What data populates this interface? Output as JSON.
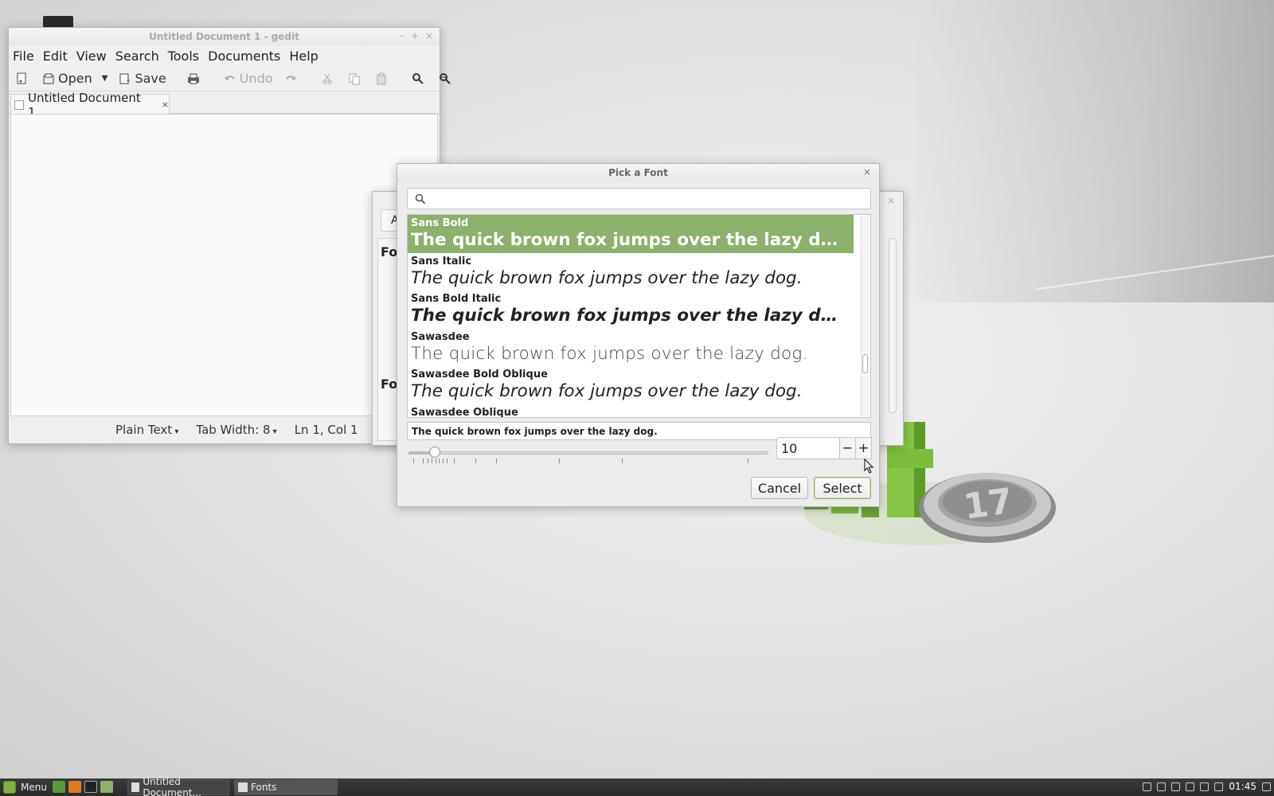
{
  "gedit": {
    "title": "Untitled Document 1 - gedit",
    "window_controls": [
      "–",
      "+",
      "×"
    ],
    "menu": [
      "File",
      "Edit",
      "View",
      "Search",
      "Tools",
      "Documents",
      "Help"
    ],
    "toolbar": {
      "open_label": "Open",
      "save_label": "Save",
      "undo_label": "Undo"
    },
    "tab": {
      "label": "Untitled Document 1",
      "close": "×"
    },
    "status": {
      "language": "Plain Text",
      "tab_width": "Tab Width:  8",
      "position": "Ln 1, Col 1"
    }
  },
  "fonts_window": {
    "button_partial": "A",
    "label_1": "Fo",
    "label_2": "Fo",
    "close": "×"
  },
  "dialog": {
    "title": "Pick a Font",
    "close": "×",
    "search_placeholder": "",
    "fonts": [
      {
        "name": "Sans Bold",
        "sample": "The quick brown fox jumps over the lazy d…",
        "style": "bold",
        "selected": true
      },
      {
        "name": "Sans Italic",
        "sample": "The quick brown fox jumps over the lazy dog.",
        "style": "italic",
        "selected": false
      },
      {
        "name": "Sans Bold Italic",
        "sample": "The quick brown fox jumps over the lazy d…",
        "style": "bolditalic",
        "selected": false
      },
      {
        "name": "Sawasdee",
        "sample": "The quick brown fox jumps over the lazy dog.",
        "style": "light",
        "selected": false
      },
      {
        "name": "Sawasdee Bold Oblique",
        "sample": "The quick brown fox jumps over the lazy dog.",
        "style": "italic",
        "selected": false
      },
      {
        "name": "Sawasdee Oblique",
        "sample": "",
        "style": "italic",
        "selected": false
      }
    ],
    "preview_text": "The quick brown fox jumps over the lazy dog.",
    "size_value": "10",
    "size_fraction": 0.07,
    "minus": "−",
    "plus": "+",
    "cancel_label": "Cancel",
    "select_label": "Select"
  },
  "taskbar": {
    "menu_label": "Menu",
    "tasks": [
      "Untitled Document...",
      "Fonts"
    ],
    "clock": "01:45"
  },
  "colors": {
    "selection": "#8bb16b",
    "mint_green": "#7eb144"
  }
}
